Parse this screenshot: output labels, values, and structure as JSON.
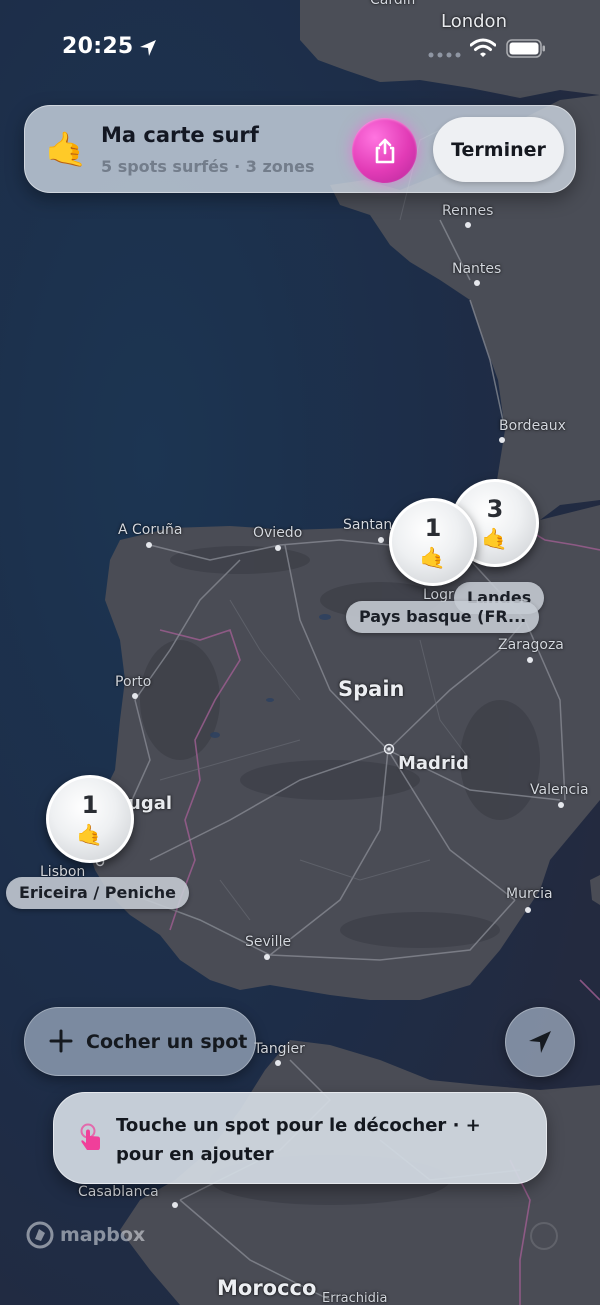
{
  "status_bar": {
    "time": "20:25",
    "location_icon": "location-arrow-icon",
    "wifi_icon": "wifi-icon",
    "battery_icon": "battery-icon"
  },
  "header": {
    "emoji": "🤙",
    "title": "Ma carte surf",
    "subtitle": "5 spots surfés · 3 zones",
    "share_icon": "share-icon",
    "finish_label": "Terminer"
  },
  "map": {
    "places": [
      {
        "name": "Cardiff",
        "kind": "city"
      },
      {
        "name": "London",
        "kind": "city"
      },
      {
        "name": "Rennes",
        "kind": "city"
      },
      {
        "name": "Nantes",
        "kind": "city"
      },
      {
        "name": "Bordeaux",
        "kind": "city"
      },
      {
        "name": "A Coruña",
        "kind": "city"
      },
      {
        "name": "Oviedo",
        "kind": "city"
      },
      {
        "name": "Santan",
        "kind": "city"
      },
      {
        "name": "Logr",
        "kind": "city"
      },
      {
        "name": "Zaragoza",
        "kind": "city"
      },
      {
        "name": "Porto",
        "kind": "city"
      },
      {
        "name": "Spain",
        "kind": "country"
      },
      {
        "name": "Madrid",
        "kind": "capital"
      },
      {
        "name": "ugal",
        "kind": "country"
      },
      {
        "name": "Valencia",
        "kind": "city"
      },
      {
        "name": "Lisbon",
        "kind": "city"
      },
      {
        "name": "Murcia",
        "kind": "city"
      },
      {
        "name": "Seville",
        "kind": "city"
      },
      {
        "name": "Tangier",
        "kind": "city"
      },
      {
        "name": "Casablanca",
        "kind": "city"
      },
      {
        "name": "Morocco",
        "kind": "country"
      },
      {
        "name": "Errachidia",
        "kind": "city"
      }
    ],
    "markers": [
      {
        "count": "3",
        "emoji": "🤙",
        "label": "Landes"
      },
      {
        "count": "1",
        "emoji": "🤙",
        "label": "Pays basque (FR..."
      },
      {
        "count": "1",
        "emoji": "🤙",
        "label": "Ericeira / Peniche"
      }
    ],
    "attribution": "mapbox"
  },
  "controls": {
    "add_label": "Cocher un spot",
    "add_icon": "plus-icon",
    "locate_icon": "navigation-arrow-icon",
    "hint_icon": "tap-hand-icon",
    "hint_text": "Touche un spot pour le décocher · + pour en ajouter"
  },
  "colors": {
    "ocean": "#1f2c46",
    "land": "#4a4d55",
    "share_accent": "#e23bb6"
  }
}
